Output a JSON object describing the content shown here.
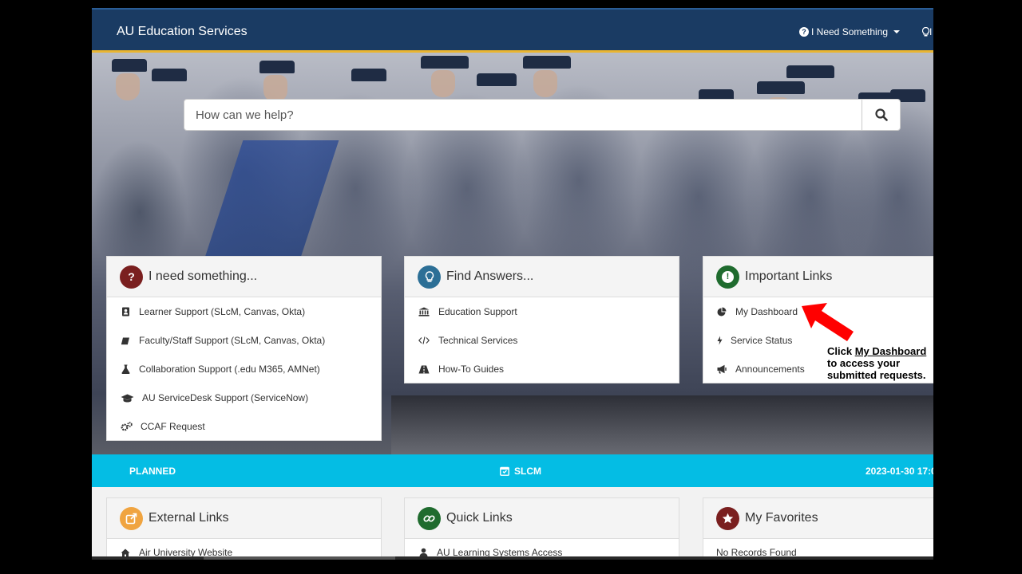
{
  "header": {
    "brand": "AU Education Services",
    "need_menu": "I Need Something",
    "bulb_menu": "I"
  },
  "search": {
    "placeholder": "How can we help?"
  },
  "cards_top": [
    {
      "title": "I need something...",
      "badge_color": "#7a1f1f",
      "items": [
        "Learner Support (SLcM, Canvas, Okta)",
        "Faculty/Staff Support (SLcM, Canvas, Okta)",
        "Collaboration Support (.edu M365, AMNet)",
        "AU ServiceDesk Support (ServiceNow)",
        "CCAF Request"
      ]
    },
    {
      "title": "Find Answers...",
      "badge_color": "#2c6f96",
      "items": [
        "Education Support",
        "Technical Services",
        "How-To Guides"
      ]
    },
    {
      "title": "Important Links",
      "badge_color": "#1f6b2e",
      "items": [
        "My Dashboard",
        "Service Status",
        "Announcements"
      ]
    }
  ],
  "status_bar": {
    "state": "PLANNED",
    "service": "SLCM",
    "date": "2023-01-30 17:0"
  },
  "cards_bottom": [
    {
      "title": "External Links",
      "badge_color": "#f0a440",
      "first_item": "Air University Website"
    },
    {
      "title": "Quick Links",
      "badge_color": "#1f6b2e",
      "first_item": "AU Learning Systems Access"
    },
    {
      "title": "My Favorites",
      "badge_color": "#7a1f1f",
      "first_item": "No Records Found"
    }
  ],
  "annotation": {
    "line1_prefix": "Click ",
    "line1_link": "My Dashboard",
    "line2": "to access your",
    "line3": "submitted requests."
  },
  "colors": {
    "header": "#1a3b63",
    "accent_gold": "#e9b531",
    "status_bar": "#04bde4",
    "arrow": "#ff0000"
  }
}
